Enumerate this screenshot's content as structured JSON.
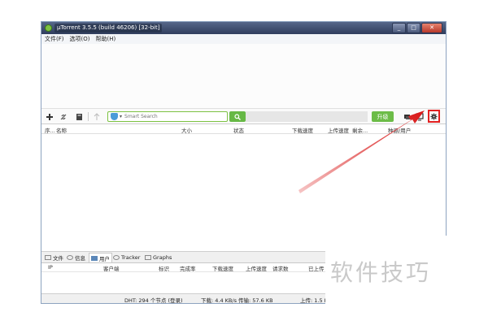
{
  "window": {
    "title": "µTorrent 3.5.5  (build 46206) [32-bit]"
  },
  "menu": [
    "文件(F)",
    "选项(O)",
    "帮助(H)"
  ],
  "toolbar": {
    "search_placeholder": "Smart Search",
    "upgrade_label": "升级",
    "icons": [
      "add-icon",
      "link-icon",
      "create-icon",
      "up-icon",
      "search-icon",
      "chat-icon",
      "remote-icon",
      "gear-icon"
    ]
  },
  "columns": [
    "序...",
    "名称",
    "大小",
    "状态",
    "下载速度",
    "上传速度",
    "剩余...",
    "种源/用户"
  ],
  "tabs": [
    "文件",
    "信息",
    "用户",
    "Tracker",
    "Graphs"
  ],
  "peer_columns": [
    "IP",
    "客户端",
    "标识",
    "完成率",
    "下载速度",
    "上传速度",
    "请求数",
    "已上传"
  ],
  "status": {
    "dht": "DHT: 294 个节点  (登录)",
    "download": "下载: 4.4 KB/s 传输: 57.6 KB",
    "upload": "上传: 1.5 K"
  },
  "watermark": "软件技巧",
  "colors": {
    "accent_green": "#66b845",
    "highlight_red": "#e22020"
  }
}
